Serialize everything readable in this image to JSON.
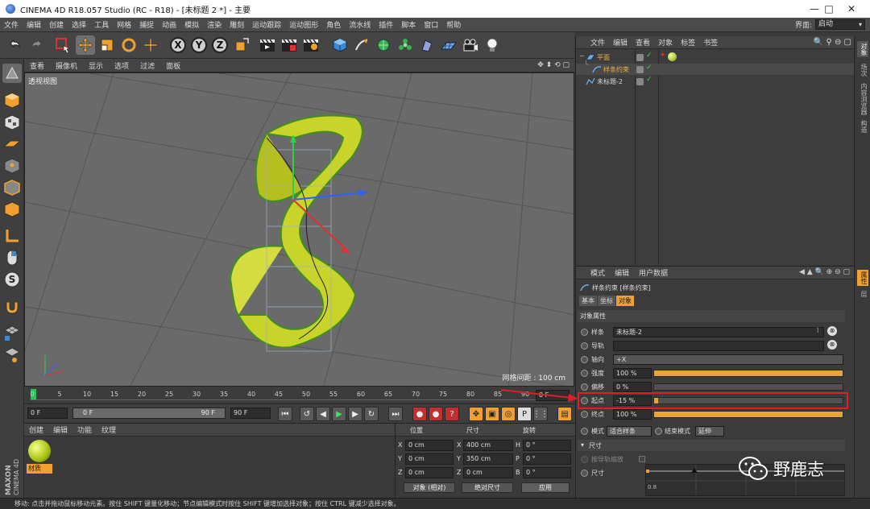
{
  "window": {
    "title": "CINEMA 4D R18.057 Studio (RC - R18) - [未标题 2 *] - 主要",
    "minimize_icon": "minimize-icon",
    "maximize_icon": "maximize-icon",
    "close_icon": "close-icon"
  },
  "menubar": {
    "items": [
      "文件",
      "编辑",
      "创建",
      "选择",
      "工具",
      "网格",
      "捕捉",
      "动画",
      "模拟",
      "渲染",
      "雕刻",
      "运动跟踪",
      "运动图形",
      "角色",
      "流水线",
      "插件",
      "脚本",
      "窗口",
      "帮助"
    ],
    "interface_label": "界面:",
    "interface_value": "启动"
  },
  "toolbar": {
    "axis_labels": [
      "X",
      "Y",
      "Z"
    ]
  },
  "viewport": {
    "menu": [
      "查看",
      "摄像机",
      "显示",
      "选项",
      "过滤",
      "面板"
    ],
    "label": "透视视图",
    "grid_info": "网格间距 : 100 cm"
  },
  "timeline": {
    "ticks": [
      "0",
      "5",
      "10",
      "15",
      "20",
      "25",
      "30",
      "35",
      "40",
      "45",
      "50",
      "55",
      "60",
      "65",
      "70",
      "75",
      "80",
      "85",
      "90"
    ],
    "current_frame_right": "0 F",
    "start_frame": "0 F",
    "range_left": "0 F",
    "range_right": "90 F",
    "end_frame": "90 F"
  },
  "material_panel": {
    "menu": [
      "创建",
      "编辑",
      "功能",
      "纹理"
    ],
    "material_name": "材质"
  },
  "coordinates": {
    "headers": [
      "位置",
      "尺寸",
      "旋转"
    ],
    "rows": [
      {
        "pos_axis": "X",
        "pos": "0 cm",
        "size_axis": "X",
        "size": "400 cm",
        "rot_axis": "H",
        "rot": "0 °"
      },
      {
        "pos_axis": "Y",
        "pos": "0 cm",
        "size_axis": "Y",
        "size": "350 cm",
        "rot_axis": "P",
        "rot": "0 °"
      },
      {
        "pos_axis": "Z",
        "pos": "0 cm",
        "size_axis": "Z",
        "size": "0 cm",
        "rot_axis": "B",
        "rot": "0 °"
      }
    ],
    "mode_left": "对象 (相对)",
    "mode_right": "绝对尺寸",
    "apply_label": "应用"
  },
  "object_manager": {
    "menu": [
      "文件",
      "编辑",
      "查看",
      "对象",
      "标签",
      "书签"
    ],
    "objects": [
      {
        "name": "平面",
        "color": "#e8b040"
      },
      {
        "name": "样条约束",
        "color": "#e8b040"
      },
      {
        "name": "未标题-2",
        "color": "#d8d8d8"
      }
    ]
  },
  "attribute_manager": {
    "menu": [
      "模式",
      "编辑",
      "用户数据"
    ],
    "title": "样条约束 [样条约束]",
    "tabs": [
      "基本",
      "坐标",
      "对象"
    ],
    "section": "对象属性",
    "rows": {
      "spline_label": "样条",
      "spline_value": "未标题-2",
      "rail_label": "导轨",
      "axis_label": "轴向",
      "axis_value": "+X",
      "strength_label": "强度",
      "strength_value": "100 %",
      "offset_label": "偏移",
      "offset_value": "0 %",
      "start_label": "起点",
      "start_value": "-15 %",
      "end_label": "终点",
      "end_value": "100 %",
      "mode_label": "模式",
      "mode_value": "适合样条",
      "end_mode_label": "结束模式",
      "end_mode_value": "延伸",
      "size_section": "尺寸",
      "along_rail_label": "按导轨缩放",
      "size_label": "尺寸",
      "graph_tick": "0.8"
    },
    "strength_fraction": 1.0,
    "offset_fraction": 0.0,
    "start_fraction": 0.0,
    "end_fraction": 1.0
  },
  "right_tabs": [
    "对象",
    "场次",
    "内容浏览器",
    "构造"
  ],
  "right_tabs_lower": [
    "属性",
    "层"
  ],
  "status": {
    "text": "移动: 点击并拖动鼠标移动元素。按住 SHIFT 键量化移动；节点编辑模式时按住 SHIFT 键增加选择对象；按住 CTRL 键减少选择对象。"
  },
  "logo": {
    "text": "MAXON CINEMA 4D"
  },
  "watermark": {
    "text": "野鹿志"
  },
  "colors": {
    "accent": "#e8a33a",
    "highlight_box": "#e02020",
    "object_yellow": "#c9d42a"
  }
}
